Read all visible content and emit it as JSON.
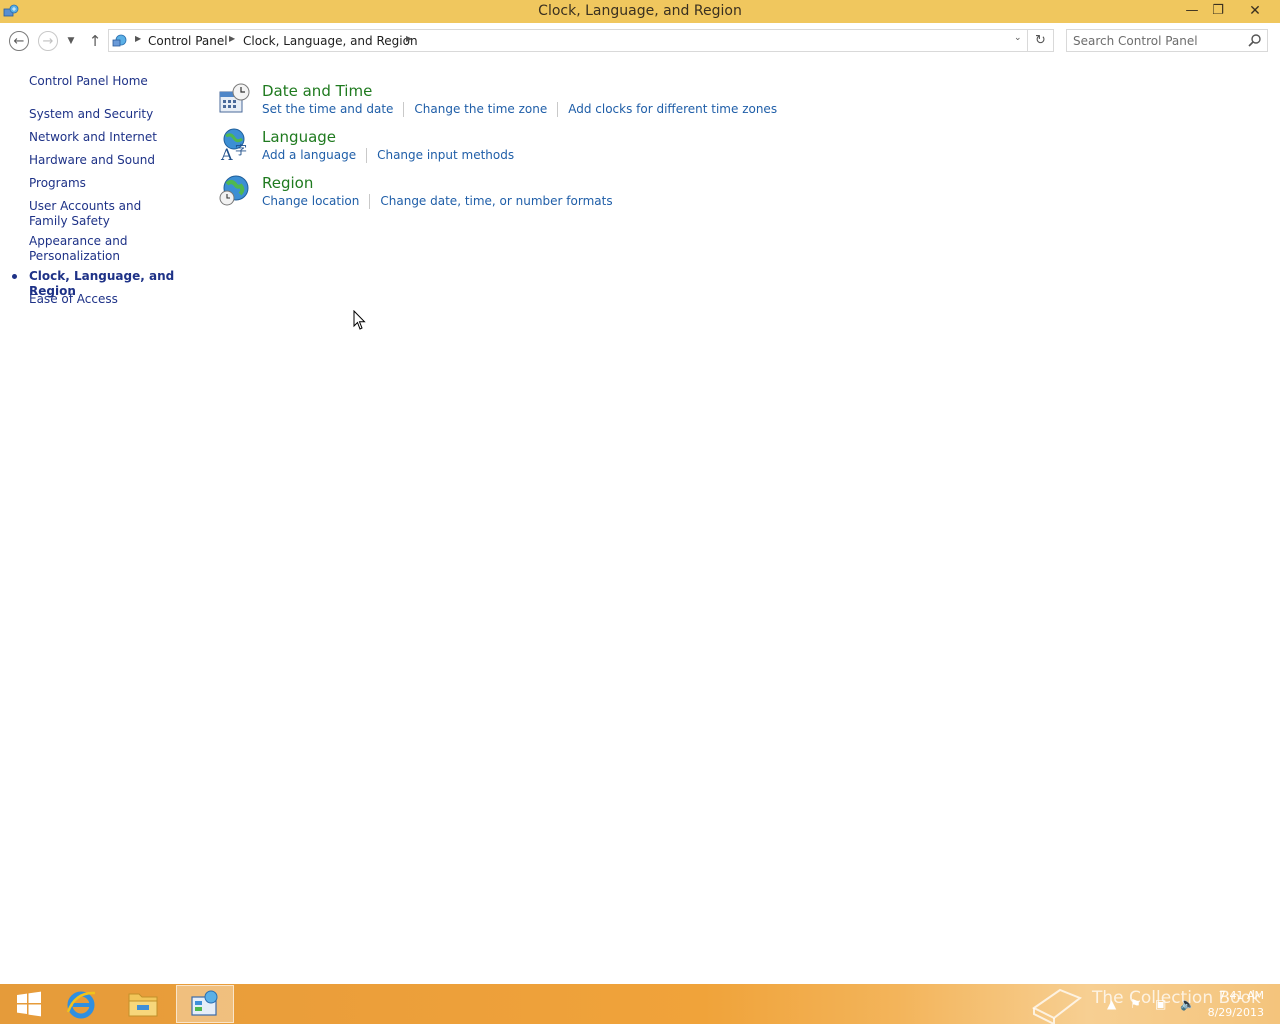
{
  "window": {
    "title": "Clock, Language, and Region",
    "minimize_glyph": "—",
    "maximize_glyph": "❐",
    "close_glyph": "✕"
  },
  "nav": {
    "back_glyph": "←",
    "forward_glyph": "→",
    "recent_glyph": "▼",
    "up_glyph": "↑",
    "breadcrumb": [
      "Control Panel",
      "Clock, Language, and Region"
    ],
    "refresh_glyph": "↻",
    "dropdown_glyph": "⌄",
    "search_placeholder": "Search Control Panel"
  },
  "sidebar": {
    "items": [
      {
        "label": "Control Panel Home"
      },
      {
        "label": "System and Security"
      },
      {
        "label": "Network and Internet"
      },
      {
        "label": "Hardware and Sound"
      },
      {
        "label": "Programs"
      },
      {
        "label": "User Accounts and Family Safety"
      },
      {
        "label": "Appearance and Personalization"
      },
      {
        "label": "Clock, Language, and Region"
      },
      {
        "label": "Ease of Access"
      }
    ],
    "current_index": 7
  },
  "categories": [
    {
      "title": "Date and Time",
      "icon": "date-time-icon",
      "links": [
        "Set the time and date",
        "Change the time zone",
        "Add clocks for different time zones"
      ]
    },
    {
      "title": "Language",
      "icon": "language-icon",
      "links": [
        "Add a language",
        "Change input methods"
      ]
    },
    {
      "title": "Region",
      "icon": "region-icon",
      "links": [
        "Change location",
        "Change date, time, or number formats"
      ]
    }
  ],
  "taskbar": {
    "watermark": "The Collection Book",
    "time": "7:41 AM",
    "date": "8/29/2013",
    "pinned": [
      "start-button",
      "internet-explorer",
      "file-explorer",
      "control-panel"
    ]
  },
  "colors": {
    "titlebar": "#f0c75e",
    "link": "#1f5ea8",
    "category_title": "#1f7a1f",
    "sidebar_link": "#1e3287"
  }
}
